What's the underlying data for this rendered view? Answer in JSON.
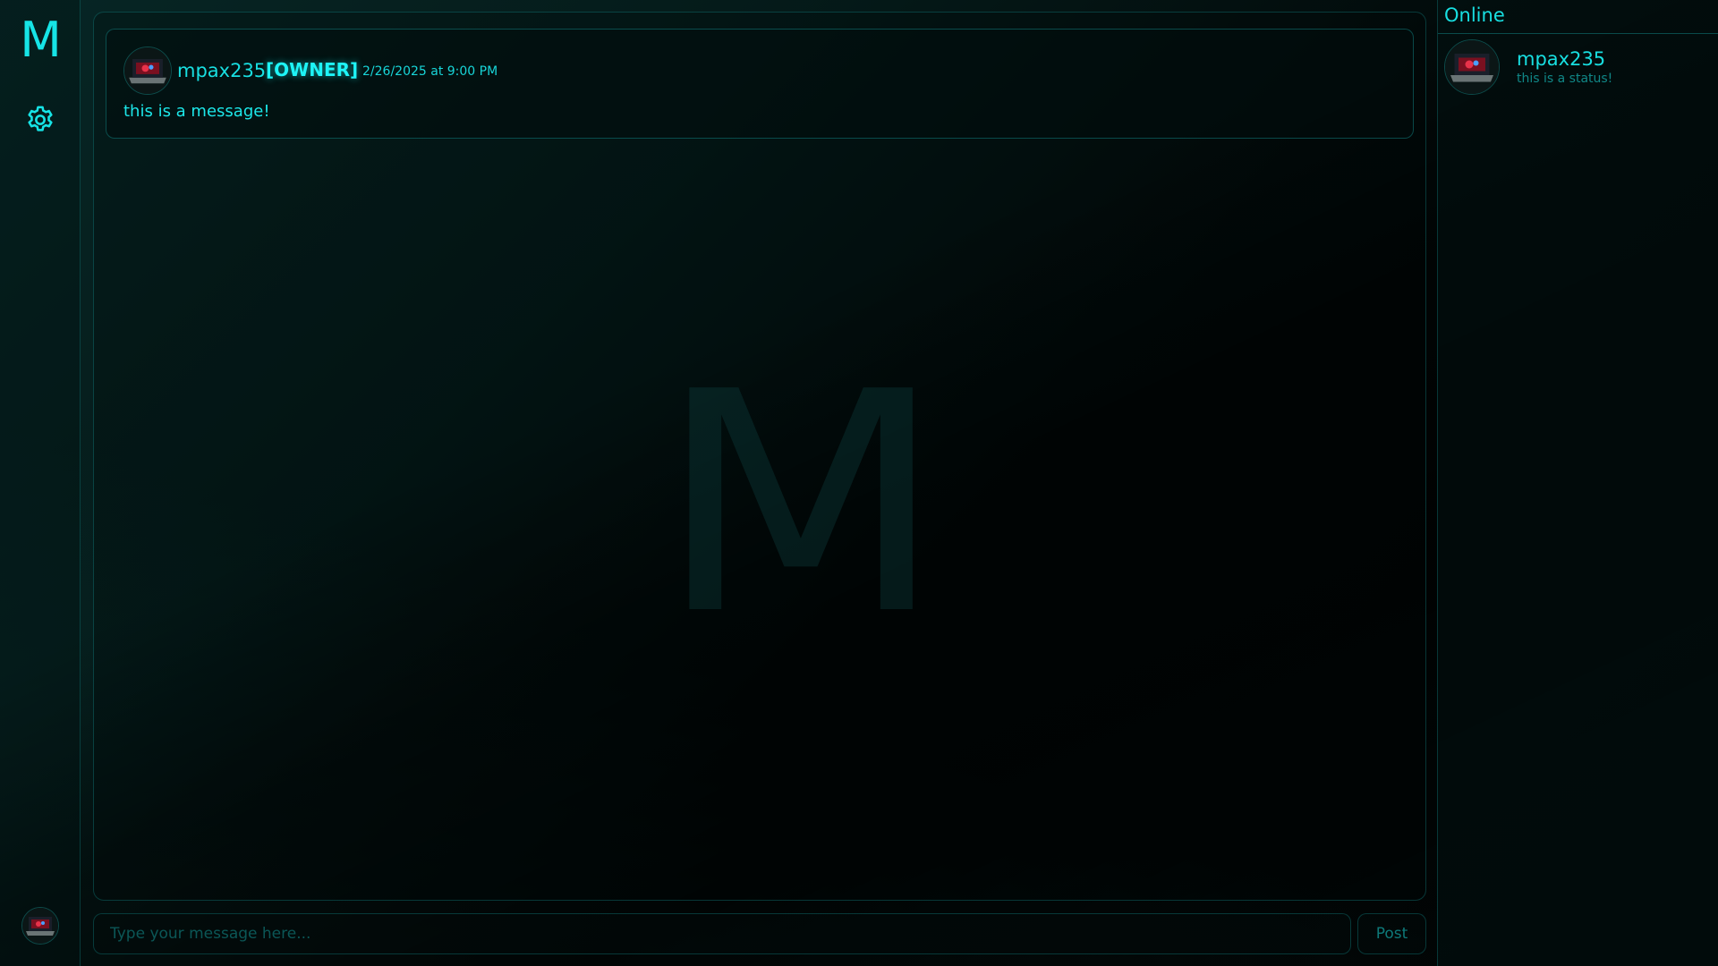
{
  "app": {
    "logo_letter": "M",
    "watermark_letter": "M",
    "accent_color": "#14d9dc"
  },
  "rail": {
    "settings_icon": "gear-icon",
    "user_avatar_icon": "laptop-avatar-icon"
  },
  "messages": [
    {
      "username": "mpax235",
      "role": "[OWNER]",
      "timestamp": "2/26/2025 at 9:00 PM",
      "text": "this is a message!"
    }
  ],
  "composer": {
    "placeholder": "Type your message here...",
    "value": "",
    "post_label": "Post"
  },
  "online": {
    "title": "Online",
    "users": [
      {
        "username": "mpax235",
        "status": "this is a status!"
      }
    ]
  }
}
